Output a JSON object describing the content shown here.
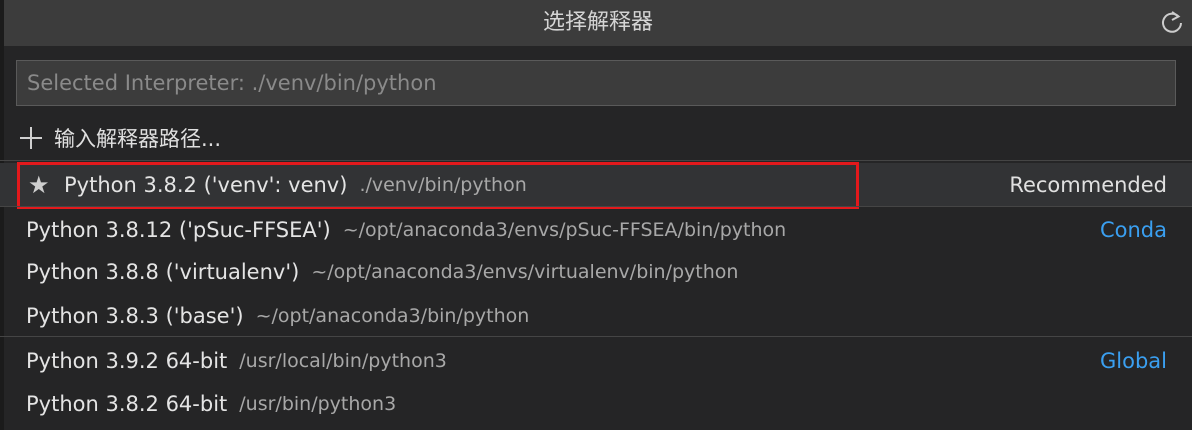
{
  "quick_pick": {
    "title": "选择解释器",
    "refresh_icon": "refresh-icon",
    "search": {
      "value": "",
      "placeholder": "Selected Interpreter: ./venv/bin/python"
    },
    "enter_path": {
      "icon": "plus-icon",
      "label": "输入解释器路径..."
    },
    "items": [
      {
        "label": "Python 3.8.2 ('venv': venv)",
        "path": "./venv/bin/python",
        "tag": "Recommended",
        "icon": "star-icon"
      },
      {
        "label": "Python 3.8.12 ('pSuc-FFSEA')",
        "path": "~/opt/anaconda3/envs/pSuc-FFSEA/bin/python",
        "tag": "Conda"
      },
      {
        "label": "Python 3.8.8 ('virtualenv')",
        "path": "~/opt/anaconda3/envs/virtualenv/bin/python",
        "tag": ""
      },
      {
        "label": "Python 3.8.3 ('base')",
        "path": "~/opt/anaconda3/bin/python",
        "tag": ""
      },
      {
        "label": "Python 3.9.2 64-bit",
        "path": "/usr/local/bin/python3",
        "tag": "Global"
      },
      {
        "label": "Python 3.8.2 64-bit",
        "path": "/usr/bin/python3",
        "tag": ""
      }
    ]
  },
  "colors": {
    "title_bar": "#3c3c3c",
    "panel": "#252526",
    "focused_row": "#323335",
    "tag_blue": "#3a9ff0",
    "highlight_border": "#e3191c"
  }
}
